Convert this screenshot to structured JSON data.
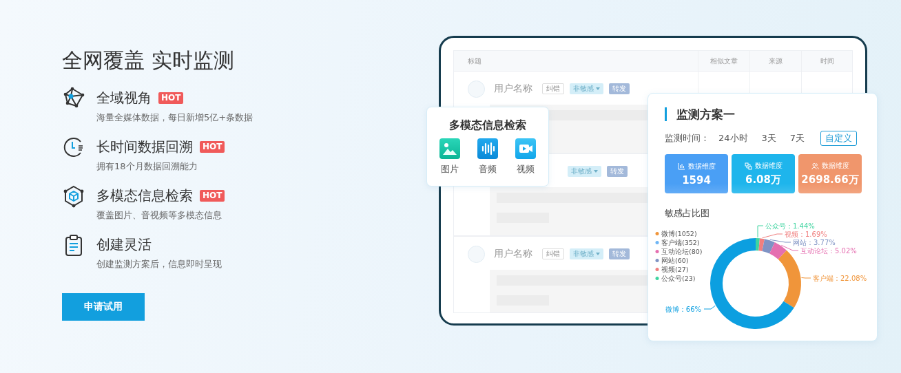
{
  "hero": {
    "title": "全网覆盖 实时监测",
    "features": [
      {
        "title": "全域视角",
        "badge": "HOT",
        "description": "海量全媒体数据，每日新增5亿+条数据"
      },
      {
        "title": "长时间数据回溯",
        "badge": "HOT",
        "description": "拥有18个月数据回溯能力"
      },
      {
        "title": "多模态信息检索",
        "badge": "HOT",
        "description": "覆盖图片、音视频等多模态信息"
      },
      {
        "title": "创建灵活",
        "description": "创建监测方案后，信息即时呈现"
      }
    ],
    "cta": "申请试用"
  },
  "tablet": {
    "table": {
      "columns": [
        "标题",
        "相似文章",
        "来源",
        "时间"
      ],
      "rows": [
        {
          "user": "用户名称",
          "tags": [
            {
              "kind": "correct",
              "label": "纠错"
            },
            {
              "kind": "sentiment",
              "label": "非敏感"
            },
            {
              "kind": "forward",
              "label": "转发"
            }
          ]
        },
        {
          "tags": [
            {
              "kind": "sentiment",
              "label": "非敏感"
            },
            {
              "kind": "forward",
              "label": "转发"
            }
          ]
        },
        {
          "user": "用户名称",
          "tags": [
            {
              "kind": "correct",
              "label": "纠错"
            },
            {
              "kind": "sentiment",
              "label": "非敏感"
            },
            {
              "kind": "forward",
              "label": "转发"
            }
          ]
        }
      ]
    }
  },
  "search_card": {
    "title": "多模态信息检索",
    "types": [
      "图片",
      "音频",
      "视频"
    ]
  },
  "plan_card": {
    "title": "监测方案一",
    "time_label": "监测时间：",
    "time_options": [
      {
        "label": "24小时",
        "selected": false
      },
      {
        "label": "3天",
        "selected": false
      },
      {
        "label": "7天",
        "selected": false
      },
      {
        "label": "自定义",
        "selected": true
      }
    ],
    "stats": [
      {
        "label": "数据维度",
        "value": "1594",
        "color": "#4a9ff5"
      },
      {
        "label": "数据维度",
        "value": "6.08万",
        "color": "#1eb5ec"
      },
      {
        "label": "数据维度",
        "value": "2698.66万",
        "color": "#f0966c"
      }
    ],
    "chart": {
      "title": "敏感占比图",
      "legend": [
        {
          "label": "微博(1052)",
          "color": "#f0953a"
        },
        {
          "label": "客户端(352)",
          "color": "#6fb6f5"
        },
        {
          "label": "互动论坛(80)",
          "color": "#e56fb0"
        },
        {
          "label": "网站(60)",
          "color": "#7f93c4"
        },
        {
          "label": "视频(27)",
          "color": "#f07f7f"
        },
        {
          "label": "公众号(23)",
          "color": "#3fd4a0"
        }
      ],
      "slices": [
        {
          "color": "#3fd4a0",
          "value": "1.44"
        },
        {
          "color": "#f07f7f",
          "value": "1.69"
        },
        {
          "color": "#7f93c4",
          "value": "3.77"
        },
        {
          "color": "#e56fb0",
          "value": "5.02"
        },
        {
          "color": "#f0953a",
          "value": "22.08"
        },
        {
          "color": "#0c9fe0",
          "value": "66"
        }
      ],
      "label_separator": "：",
      "value_suffix": "%",
      "chart_data": {
        "type": "donut",
        "categories": [
          "公众号",
          "视频",
          "网站",
          "互动论坛",
          "客户端",
          "微博"
        ],
        "values": [
          1.44,
          1.69,
          3.77,
          5.02,
          22.08,
          66
        ]
      }
    }
  }
}
